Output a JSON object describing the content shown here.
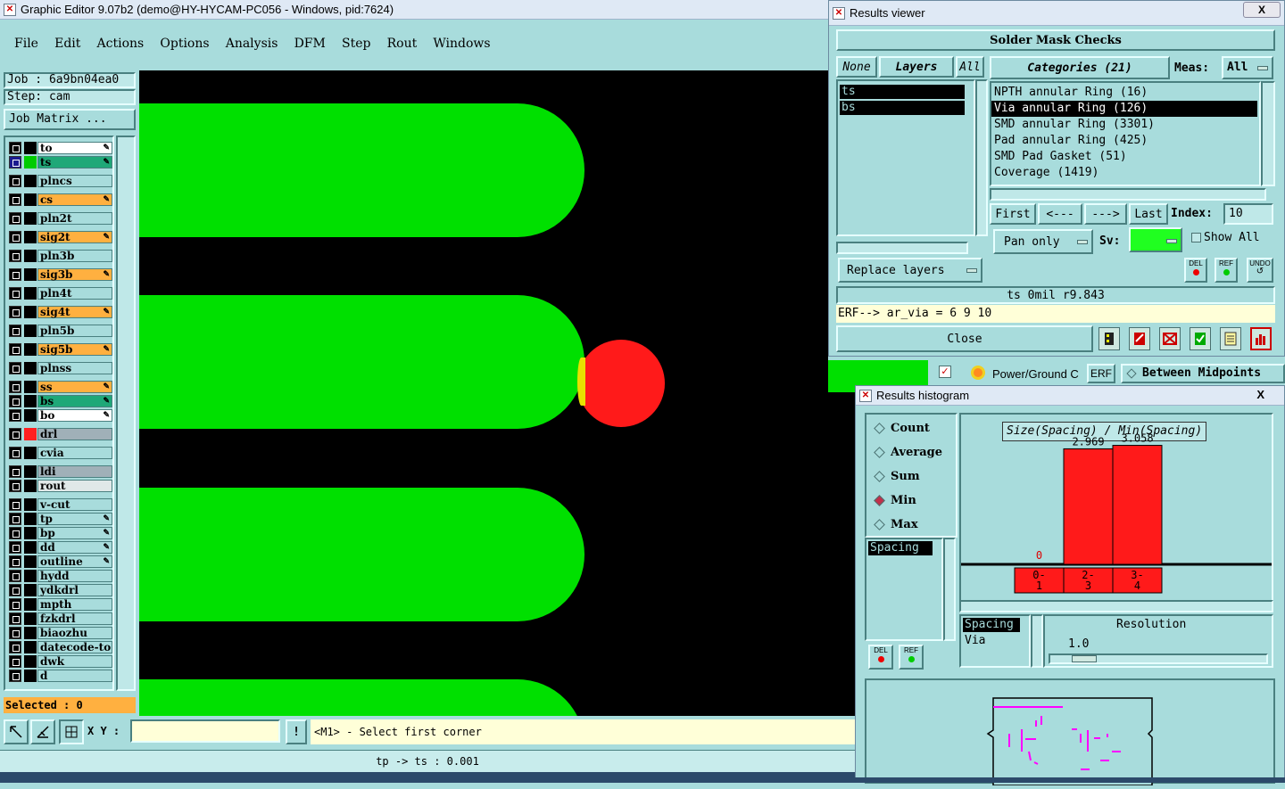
{
  "main": {
    "title": "Graphic Editor 9.07b2 (demo@HY-HYCAM-PC056 - Windows, pid:7624)",
    "menu": [
      "File",
      "Edit",
      "Actions",
      "Options",
      "Analysis",
      "DFM",
      "Step",
      "Rout",
      "Windows"
    ],
    "job": "Job :  6a9bn04ea0",
    "step": "Step: cam",
    "job_matrix": "Job Matrix ...",
    "selected": "Selected : 0",
    "xy_label": "X Y :",
    "xy_value": "",
    "prompt_icon": "!",
    "prompt": "<M1> - Select first corner",
    "status": "tp -> ts : 0.001",
    "layers": [
      {
        "name": "to",
        "bg": "#ffffff",
        "mark": "✎",
        "color": "#000000"
      },
      {
        "name": "ts",
        "bg": "#1fa878",
        "mark": "✎",
        "color": "#00cc00",
        "active": true
      },
      {
        "name": "plncs",
        "bg": "#a8dcdc",
        "mark": "",
        "color": "#000000"
      },
      {
        "name": "cs",
        "bg": "#ffb040",
        "mark": "✎",
        "color": "#000000"
      },
      {
        "name": "pln2t",
        "bg": "#a8dcdc",
        "mark": "",
        "color": "#000000"
      },
      {
        "name": "sig2t",
        "bg": "#ffb040",
        "mark": "✎",
        "color": "#000000"
      },
      {
        "name": "pln3b",
        "bg": "#a8dcdc",
        "mark": "",
        "color": "#000000"
      },
      {
        "name": "sig3b",
        "bg": "#ffb040",
        "mark": "✎",
        "color": "#000000"
      },
      {
        "name": "pln4t",
        "bg": "#a8dcdc",
        "mark": "",
        "color": "#000000"
      },
      {
        "name": "sig4t",
        "bg": "#ffb040",
        "mark": "✎",
        "color": "#000000"
      },
      {
        "name": "pln5b",
        "bg": "#a8dcdc",
        "mark": "",
        "color": "#000000"
      },
      {
        "name": "sig5b",
        "bg": "#ffb040",
        "mark": "✎",
        "color": "#000000"
      },
      {
        "name": "plnss",
        "bg": "#a8dcdc",
        "mark": "",
        "color": "#000000"
      },
      {
        "name": "ss",
        "bg": "#ffb040",
        "mark": "✎",
        "color": "#000000"
      },
      {
        "name": "bs",
        "bg": "#1fa878",
        "mark": "✎",
        "color": "#000000"
      },
      {
        "name": "bo",
        "bg": "#ffffff",
        "mark": "✎",
        "color": "#000000"
      },
      {
        "name": "drl",
        "bg": "#a0b0b8",
        "mark": "",
        "color": "#ff2020"
      },
      {
        "name": "cvia",
        "bg": "#a8dcdc",
        "mark": "",
        "color": "#000000"
      },
      {
        "name": "ldi",
        "bg": "#a0b0b8",
        "mark": "",
        "color": "#000000"
      },
      {
        "name": "rout",
        "bg": "#e0e8e8",
        "mark": "",
        "color": "#000000"
      },
      {
        "name": "v-cut",
        "bg": "#a8dcdc",
        "mark": "",
        "color": "#000000"
      },
      {
        "name": "tp",
        "bg": "#a8dcdc",
        "mark": "✎",
        "color": "#000000"
      },
      {
        "name": "bp",
        "bg": "#a8dcdc",
        "mark": "✎",
        "color": "#000000"
      },
      {
        "name": "dd",
        "bg": "#a8dcdc",
        "mark": "✎",
        "color": "#000000"
      },
      {
        "name": "outline",
        "bg": "#a8dcdc",
        "mark": "✎",
        "color": "#000000"
      },
      {
        "name": "hydd",
        "bg": "#a8dcdc",
        "mark": "",
        "color": "#000000"
      },
      {
        "name": "ydkdrl",
        "bg": "#a8dcdc",
        "mark": "",
        "color": "#000000"
      },
      {
        "name": "mpth",
        "bg": "#a8dcdc",
        "mark": "",
        "color": "#000000"
      },
      {
        "name": "fzkdrl",
        "bg": "#a8dcdc",
        "mark": "",
        "color": "#000000"
      },
      {
        "name": "biaozhu",
        "bg": "#a8dcdc",
        "mark": "",
        "color": "#000000"
      },
      {
        "name": "datecode-to",
        "bg": "#a8dcdc",
        "mark": "",
        "color": "#000000"
      },
      {
        "name": "dwk",
        "bg": "#a8dcdc",
        "mark": "",
        "color": "#000000"
      },
      {
        "name": "d",
        "bg": "#a8dcdc",
        "mark": "",
        "color": "#000000"
      }
    ]
  },
  "results": {
    "title": "Results viewer",
    "close_x": "X",
    "header": "Solder Mask Checks",
    "none": "None",
    "layers_btn": "Layers",
    "all_btn": "All",
    "layers": [
      "ts",
      "bs"
    ],
    "categories_label": "Categories (21)",
    "meas_label": "Meas:",
    "meas_value": "All",
    "categories": [
      "NPTH annular Ring (16)",
      "Via annular Ring (126)",
      "SMD annular Ring (3301)",
      "Pad annular Ring (425)",
      "SMD Pad Gasket (51)",
      "Coverage (1419)"
    ],
    "selected_category": 1,
    "first": "First",
    "prev": "<---",
    "next": "--->",
    "last": "Last",
    "index_label": "Index:",
    "index_value": "10",
    "pan_mode": "Pan only",
    "sv_label": "Sv:",
    "show_all": "Show All",
    "replace_layers": "Replace layers",
    "del": "DEL",
    "ref": "REF",
    "undo": "UNDO",
    "info": "ts 0mil  r9.843",
    "erf": "ERF--> ar_via = 6 9 10",
    "close": "Close"
  },
  "mid_strip": {
    "power_ground": "Power/Ground C",
    "erf": "ERF",
    "between": "Between Midpoints"
  },
  "histogram": {
    "title": "Results histogram",
    "close_x": "X",
    "radios": [
      "Count",
      "Average",
      "Sum",
      "Min",
      "Max"
    ],
    "selected_radio": 3,
    "list": [
      "Spacing"
    ],
    "list2": [
      "Spacing",
      "Via"
    ],
    "resolution_label": "Resolution",
    "resolution_value": "1.0",
    "del": "DEL",
    "ref": "REF"
  },
  "chart_data": {
    "type": "bar",
    "title": "Size(Spacing) / Min(Spacing)",
    "categories": [
      "0-1",
      "2-3",
      "3-4"
    ],
    "category_labels": [
      [
        "0-",
        "1"
      ],
      [
        "2-",
        "3"
      ],
      [
        "3-",
        "4"
      ]
    ],
    "values": [
      0,
      2.969,
      3.058
    ],
    "value_labels": [
      "0",
      "2.969",
      "3.058"
    ],
    "ylim": [
      0,
      3.3
    ],
    "bar_color": "#ff1a1a"
  },
  "colors": {
    "board_green": "#00e000",
    "via_red": "#ff1a1a",
    "canvas": "#000000",
    "panel": "#a8dcdc",
    "yellow": "#ffffd8"
  }
}
